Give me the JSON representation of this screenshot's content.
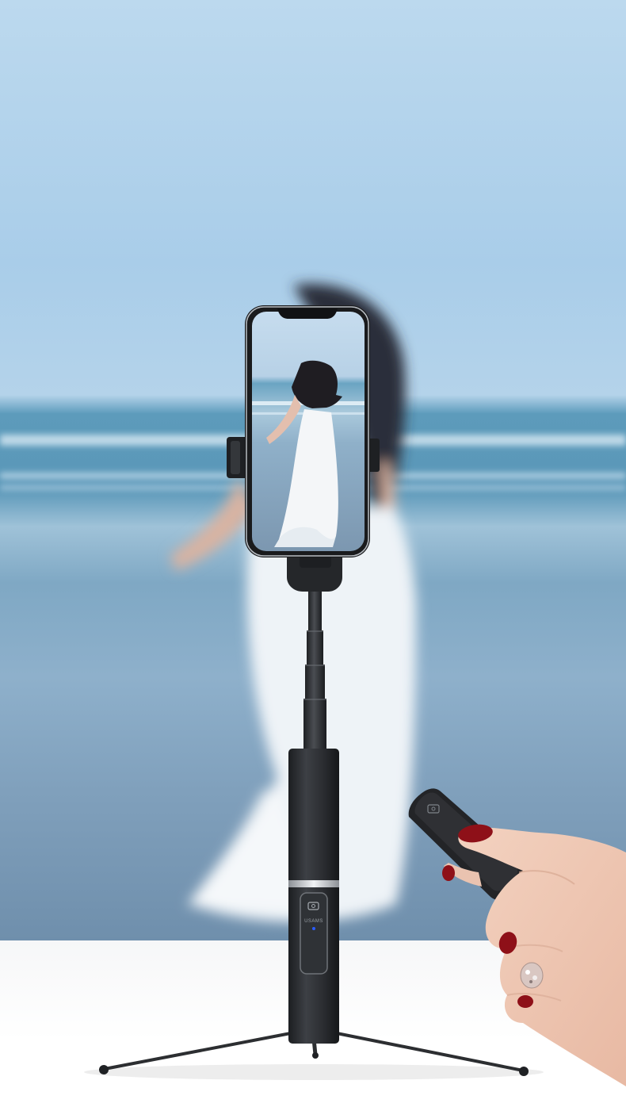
{
  "product": {
    "brand_mark": "USAMS"
  },
  "colors": {
    "sky": "#b9d7ee",
    "sea": "#5b98b9",
    "sand": "#7d9dba",
    "floor": "#ffffff",
    "device_body": "#2b2d30",
    "accent_ring": "#d9dde1",
    "nail_polish": "#8e1018",
    "status_led": "#2a5cff"
  },
  "icons": {
    "shutter_button": "camera-icon",
    "remote_button": "camera-icon"
  }
}
